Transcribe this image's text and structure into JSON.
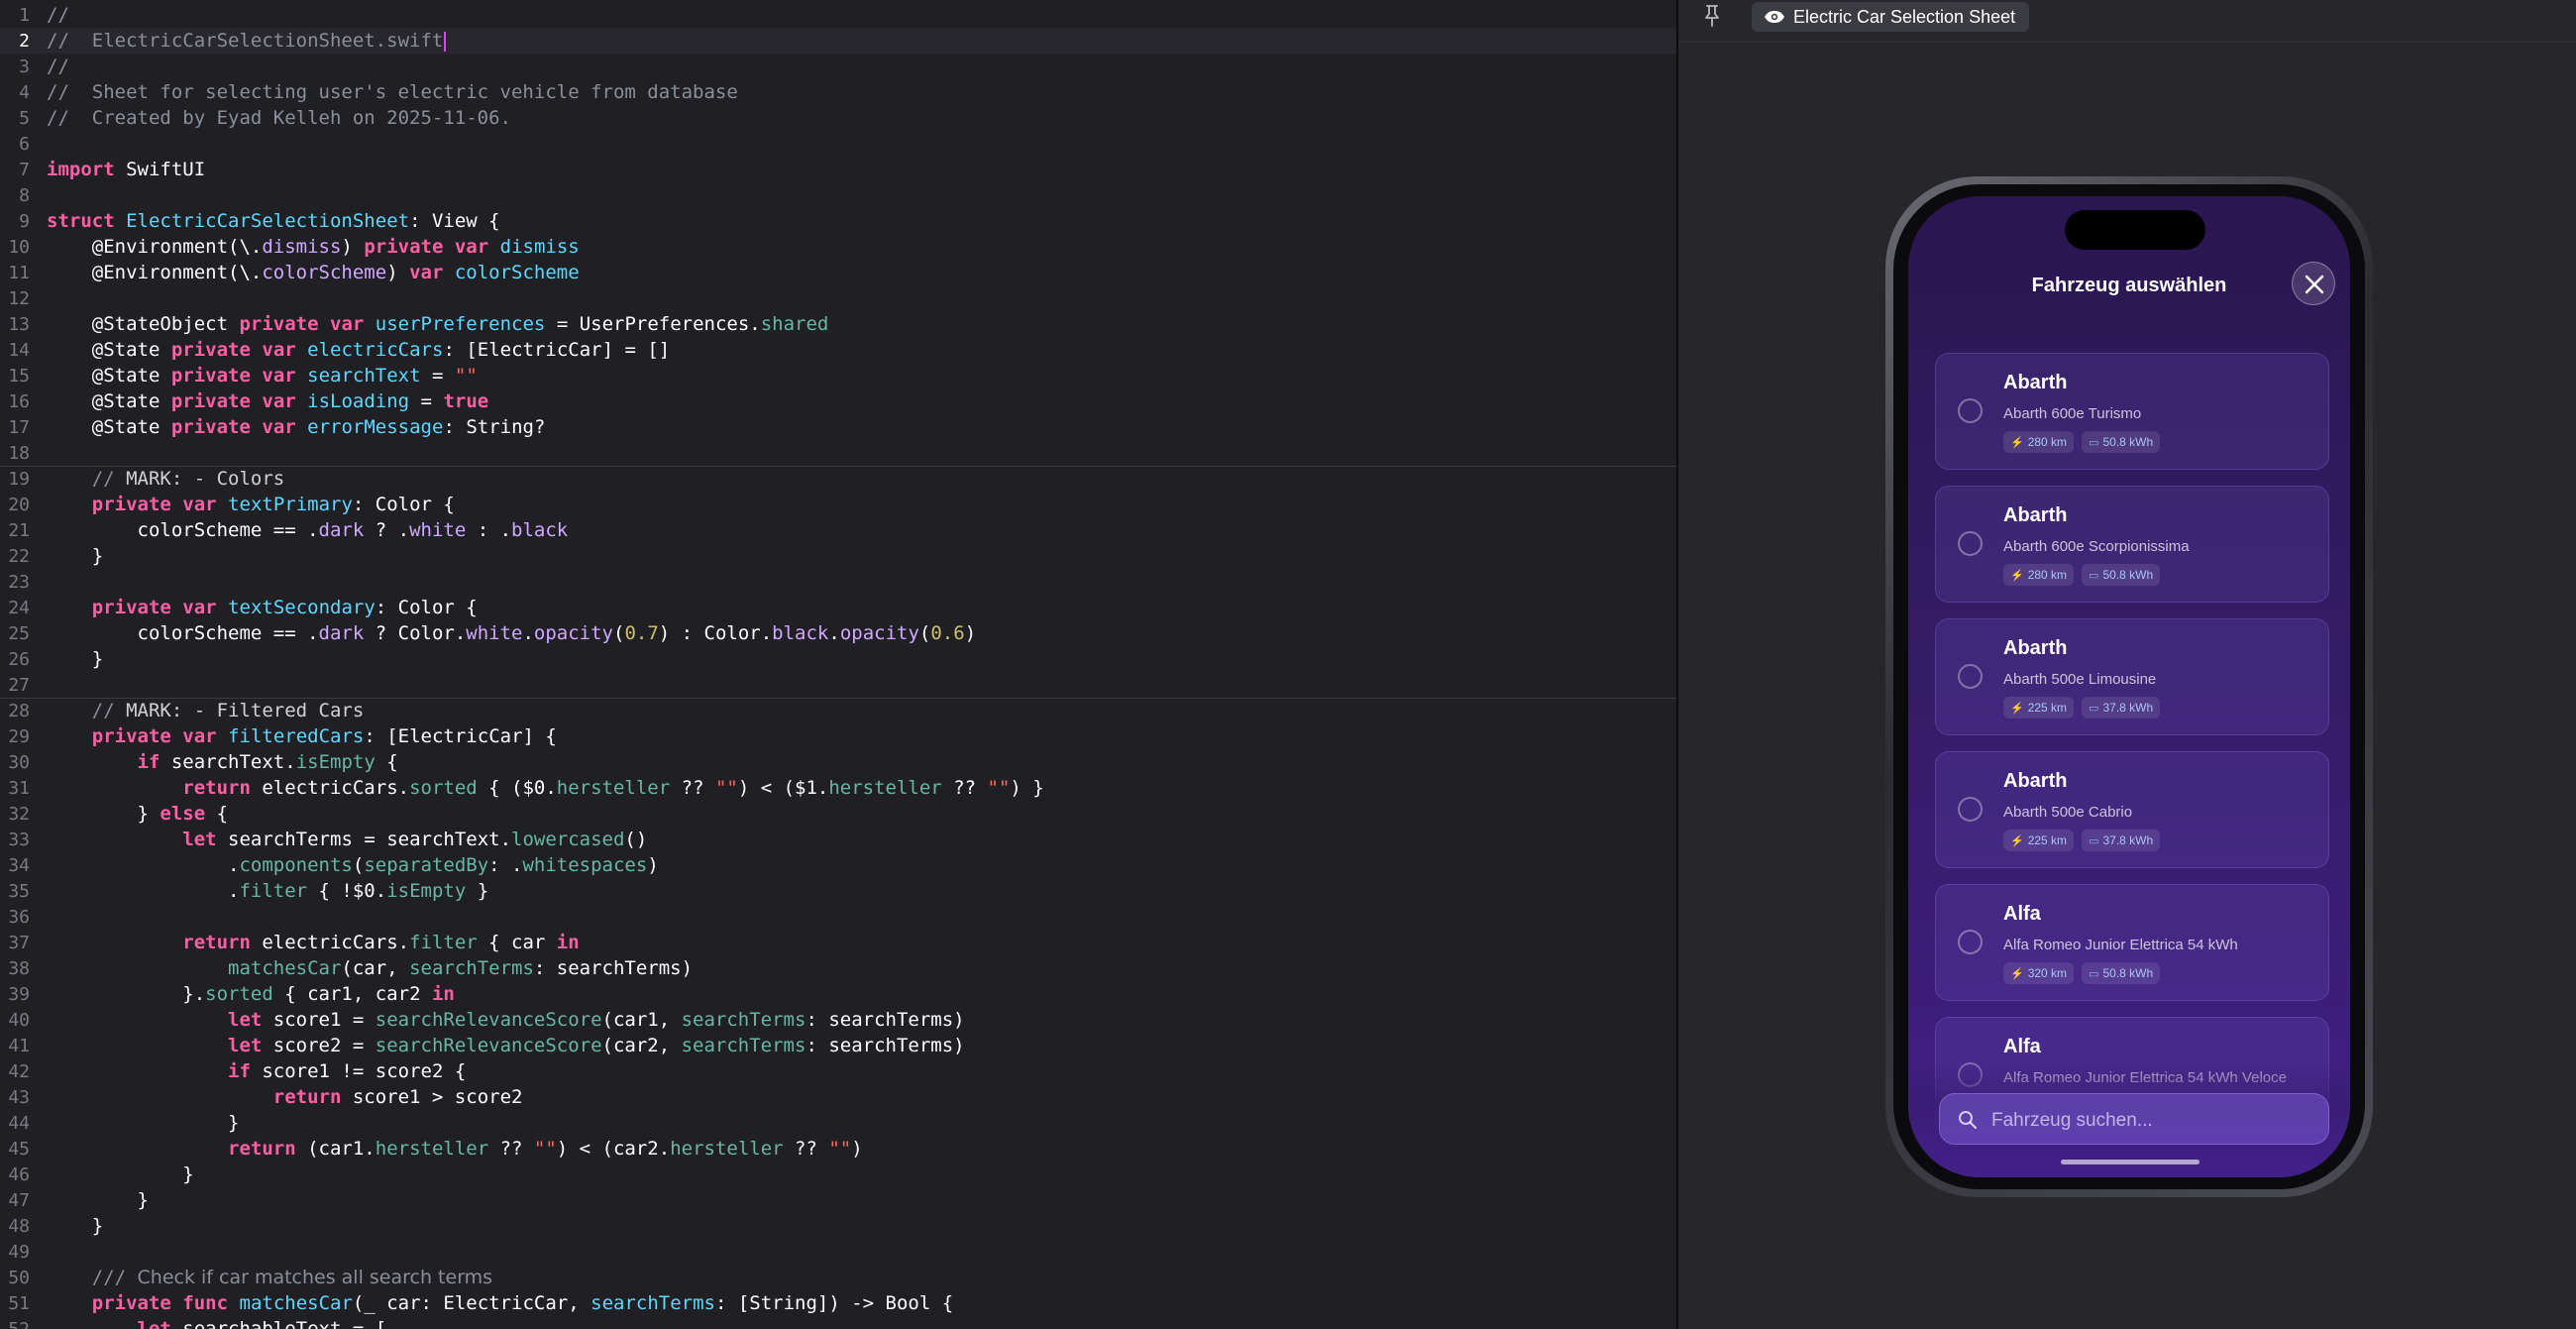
{
  "editor": {
    "lines": [
      [
        {
          "t": "//",
          "c": "cmt"
        }
      ],
      [
        {
          "t": "//  ElectricCarSelectionSheet.swift",
          "c": "cmt"
        }
      ],
      [
        {
          "t": "//",
          "c": "cmt"
        }
      ],
      [
        {
          "t": "//  Sheet for selecting user's electric vehicle from database",
          "c": "cmt"
        }
      ],
      [
        {
          "t": "//  Created by Eyad Kelleh on 2025-11-06.",
          "c": "cmt"
        }
      ],
      [],
      [
        {
          "t": "import",
          "c": "kw"
        },
        {
          "t": " SwiftUI"
        }
      ],
      [],
      [
        {
          "t": "struct",
          "c": "kw"
        },
        {
          "t": " "
        },
        {
          "t": "ElectricCarSelectionSheet",
          "c": "type"
        },
        {
          "t": ": View {"
        }
      ],
      [
        {
          "t": "    @Environment(\\."
        },
        {
          "t": "dismiss",
          "c": "attr"
        },
        {
          "t": ") "
        },
        {
          "t": "private",
          "c": "kw"
        },
        {
          "t": " "
        },
        {
          "t": "var",
          "c": "kw"
        },
        {
          "t": " "
        },
        {
          "t": "dismiss",
          "c": "type"
        }
      ],
      [
        {
          "t": "    @Environment(\\."
        },
        {
          "t": "colorScheme",
          "c": "attr"
        },
        {
          "t": ") "
        },
        {
          "t": "var",
          "c": "kw"
        },
        {
          "t": " "
        },
        {
          "t": "colorScheme",
          "c": "type"
        }
      ],
      [],
      [
        {
          "t": "    @StateObject "
        },
        {
          "t": "private",
          "c": "kw"
        },
        {
          "t": " "
        },
        {
          "t": "var",
          "c": "kw"
        },
        {
          "t": " "
        },
        {
          "t": "userPreferences",
          "c": "type"
        },
        {
          "t": " = UserPreferences."
        },
        {
          "t": "shared",
          "c": "prop"
        }
      ],
      [
        {
          "t": "    @State "
        },
        {
          "t": "private",
          "c": "kw"
        },
        {
          "t": " "
        },
        {
          "t": "var",
          "c": "kw"
        },
        {
          "t": " "
        },
        {
          "t": "electricCars",
          "c": "type"
        },
        {
          "t": ": [ElectricCar] = []"
        }
      ],
      [
        {
          "t": "    @State "
        },
        {
          "t": "private",
          "c": "kw"
        },
        {
          "t": " "
        },
        {
          "t": "var",
          "c": "kw"
        },
        {
          "t": " "
        },
        {
          "t": "searchText",
          "c": "type"
        },
        {
          "t": " = "
        },
        {
          "t": "\"\"",
          "c": "str"
        }
      ],
      [
        {
          "t": "    @State "
        },
        {
          "t": "private",
          "c": "kw"
        },
        {
          "t": " "
        },
        {
          "t": "var",
          "c": "kw"
        },
        {
          "t": " "
        },
        {
          "t": "isLoading",
          "c": "type"
        },
        {
          "t": " = "
        },
        {
          "t": "true",
          "c": "kw"
        }
      ],
      [
        {
          "t": "    @State "
        },
        {
          "t": "private",
          "c": "kw"
        },
        {
          "t": " "
        },
        {
          "t": "var",
          "c": "kw"
        },
        {
          "t": " "
        },
        {
          "t": "errorMessage",
          "c": "type"
        },
        {
          "t": ": String?"
        }
      ],
      [],
      [
        {
          "t": "    // ",
          "c": "cmt"
        },
        {
          "t": "MARK: - Colors",
          "c": "mark"
        }
      ],
      [
        {
          "t": "    "
        },
        {
          "t": "private",
          "c": "kw"
        },
        {
          "t": " "
        },
        {
          "t": "var",
          "c": "kw"
        },
        {
          "t": " "
        },
        {
          "t": "textPrimary",
          "c": "type"
        },
        {
          "t": ": Color {"
        }
      ],
      [
        {
          "t": "        colorScheme == ."
        },
        {
          "t": "dark",
          "c": "attr"
        },
        {
          "t": " ? ."
        },
        {
          "t": "white",
          "c": "attr"
        },
        {
          "t": " : ."
        },
        {
          "t": "black",
          "c": "attr"
        }
      ],
      [
        {
          "t": "    }"
        }
      ],
      [],
      [
        {
          "t": "    "
        },
        {
          "t": "private",
          "c": "kw"
        },
        {
          "t": " "
        },
        {
          "t": "var",
          "c": "kw"
        },
        {
          "t": " "
        },
        {
          "t": "textSecondary",
          "c": "type"
        },
        {
          "t": ": Color {"
        }
      ],
      [
        {
          "t": "        colorScheme == ."
        },
        {
          "t": "dark",
          "c": "attr"
        },
        {
          "t": " ? Color."
        },
        {
          "t": "white",
          "c": "attr"
        },
        {
          "t": "."
        },
        {
          "t": "opacity",
          "c": "attr"
        },
        {
          "t": "("
        },
        {
          "t": "0.7",
          "c": "num"
        },
        {
          "t": ") : Color."
        },
        {
          "t": "black",
          "c": "attr"
        },
        {
          "t": "."
        },
        {
          "t": "opacity",
          "c": "attr"
        },
        {
          "t": "("
        },
        {
          "t": "0.6",
          "c": "num"
        },
        {
          "t": ")"
        }
      ],
      [
        {
          "t": "    }"
        }
      ],
      [],
      [
        {
          "t": "    // ",
          "c": "cmt"
        },
        {
          "t": "MARK: - Filtered Cars",
          "c": "mark"
        }
      ],
      [
        {
          "t": "    "
        },
        {
          "t": "private",
          "c": "kw"
        },
        {
          "t": " "
        },
        {
          "t": "var",
          "c": "kw"
        },
        {
          "t": " "
        },
        {
          "t": "filteredCars",
          "c": "type"
        },
        {
          "t": ": [ElectricCar] {"
        }
      ],
      [
        {
          "t": "        "
        },
        {
          "t": "if",
          "c": "kw"
        },
        {
          "t": " searchText."
        },
        {
          "t": "isEmpty",
          "c": "prop"
        },
        {
          "t": " {"
        }
      ],
      [
        {
          "t": "            "
        },
        {
          "t": "return",
          "c": "kw"
        },
        {
          "t": " electricCars."
        },
        {
          "t": "sorted",
          "c": "prop"
        },
        {
          "t": " { ($0."
        },
        {
          "t": "hersteller",
          "c": "prop"
        },
        {
          "t": " ?? "
        },
        {
          "t": "\"\"",
          "c": "str"
        },
        {
          "t": ") < ($1."
        },
        {
          "t": "hersteller",
          "c": "prop"
        },
        {
          "t": " ?? "
        },
        {
          "t": "\"\"",
          "c": "str"
        },
        {
          "t": ") }"
        }
      ],
      [
        {
          "t": "        } "
        },
        {
          "t": "else",
          "c": "kw"
        },
        {
          "t": " {"
        }
      ],
      [
        {
          "t": "            "
        },
        {
          "t": "let",
          "c": "kw"
        },
        {
          "t": " searchTerms = searchText."
        },
        {
          "t": "lowercased",
          "c": "prop"
        },
        {
          "t": "()"
        }
      ],
      [
        {
          "t": "                ."
        },
        {
          "t": "components",
          "c": "prop"
        },
        {
          "t": "("
        },
        {
          "t": "separatedBy",
          "c": "prop"
        },
        {
          "t": ": ."
        },
        {
          "t": "whitespaces",
          "c": "prop"
        },
        {
          "t": ")"
        }
      ],
      [
        {
          "t": "                ."
        },
        {
          "t": "filter",
          "c": "prop"
        },
        {
          "t": " { !$0."
        },
        {
          "t": "isEmpty",
          "c": "prop"
        },
        {
          "t": " }"
        }
      ],
      [],
      [
        {
          "t": "            "
        },
        {
          "t": "return",
          "c": "kw"
        },
        {
          "t": " electricCars."
        },
        {
          "t": "filter",
          "c": "prop"
        },
        {
          "t": " { car "
        },
        {
          "t": "in",
          "c": "kw"
        }
      ],
      [
        {
          "t": "                "
        },
        {
          "t": "matchesCar",
          "c": "prop"
        },
        {
          "t": "(car, "
        },
        {
          "t": "searchTerms",
          "c": "prop"
        },
        {
          "t": ": searchTerms)"
        }
      ],
      [
        {
          "t": "            }."
        },
        {
          "t": "sorted",
          "c": "prop"
        },
        {
          "t": " { car1, car2 "
        },
        {
          "t": "in",
          "c": "kw"
        }
      ],
      [
        {
          "t": "                "
        },
        {
          "t": "let",
          "c": "kw"
        },
        {
          "t": " score1 = "
        },
        {
          "t": "searchRelevanceScore",
          "c": "prop"
        },
        {
          "t": "(car1, "
        },
        {
          "t": "searchTerms",
          "c": "prop"
        },
        {
          "t": ": searchTerms)"
        }
      ],
      [
        {
          "t": "                "
        },
        {
          "t": "let",
          "c": "kw"
        },
        {
          "t": " score2 = "
        },
        {
          "t": "searchRelevanceScore",
          "c": "prop"
        },
        {
          "t": "(car2, "
        },
        {
          "t": "searchTerms",
          "c": "prop"
        },
        {
          "t": ": searchTerms)"
        }
      ],
      [
        {
          "t": "                "
        },
        {
          "t": "if",
          "c": "kw"
        },
        {
          "t": " score1 != score2 {"
        }
      ],
      [
        {
          "t": "                    "
        },
        {
          "t": "return",
          "c": "kw"
        },
        {
          "t": " score1 > score2"
        }
      ],
      [
        {
          "t": "                }"
        }
      ],
      [
        {
          "t": "                "
        },
        {
          "t": "return",
          "c": "kw"
        },
        {
          "t": " (car1."
        },
        {
          "t": "hersteller",
          "c": "prop"
        },
        {
          "t": " ?? "
        },
        {
          "t": "\"\"",
          "c": "str"
        },
        {
          "t": ") < (car2."
        },
        {
          "t": "hersteller",
          "c": "prop"
        },
        {
          "t": " ?? "
        },
        {
          "t": "\"\"",
          "c": "str"
        },
        {
          "t": ")"
        }
      ],
      [
        {
          "t": "            }"
        }
      ],
      [
        {
          "t": "        }"
        }
      ],
      [
        {
          "t": "    }"
        }
      ],
      [],
      [
        {
          "t": "    /// ",
          "c": "cmt"
        },
        {
          "t": "Check if car matches all search terms",
          "c": "doc"
        }
      ],
      [
        {
          "t": "    "
        },
        {
          "t": "private",
          "c": "kw"
        },
        {
          "t": " "
        },
        {
          "t": "func",
          "c": "kw"
        },
        {
          "t": " "
        },
        {
          "t": "matchesCar",
          "c": "type"
        },
        {
          "t": "(_ car: ElectricCar, "
        },
        {
          "t": "searchTerms",
          "c": "type"
        },
        {
          "t": ": [String]) -> Bool {"
        }
      ],
      [
        {
          "t": "        "
        },
        {
          "t": "let",
          "c": "kw"
        },
        {
          "t": " searchableText = ["
        }
      ]
    ]
  },
  "canvas": {
    "pin_icon": "pin-icon",
    "preview_label": "Electric Car Selection Sheet"
  },
  "sheet": {
    "title": "Fahrzeug auswählen",
    "search_placeholder": "Fahrzeug suchen...",
    "cars": [
      {
        "brand": "Abarth",
        "model": "Abarth 600e Turismo",
        "range": "280 km",
        "battery": "50.8 kWh"
      },
      {
        "brand": "Abarth",
        "model": "Abarth 600e Scorpionissima",
        "range": "280 km",
        "battery": "50.8 kWh"
      },
      {
        "brand": "Abarth",
        "model": "Abarth 500e Limousine",
        "range": "225 km",
        "battery": "37.8 kWh"
      },
      {
        "brand": "Abarth",
        "model": "Abarth 500e Cabrio",
        "range": "225 km",
        "battery": "37.8 kWh"
      },
      {
        "brand": "Alfa",
        "model": "Alfa Romeo Junior Elettrica 54 kWh",
        "range": "320 km",
        "battery": "50.8 kWh"
      },
      {
        "brand": "Alfa",
        "model": "Alfa Romeo Junior Elettrica 54 kWh Veloce",
        "range": "",
        "battery": ""
      }
    ]
  },
  "colors": {
    "keyword": "#fc5fa3",
    "type": "#5dd8ff",
    "comment": "#8a8f98",
    "string": "#fc6a5d",
    "number": "#d0bf69",
    "sheet_background": "#331b62"
  }
}
